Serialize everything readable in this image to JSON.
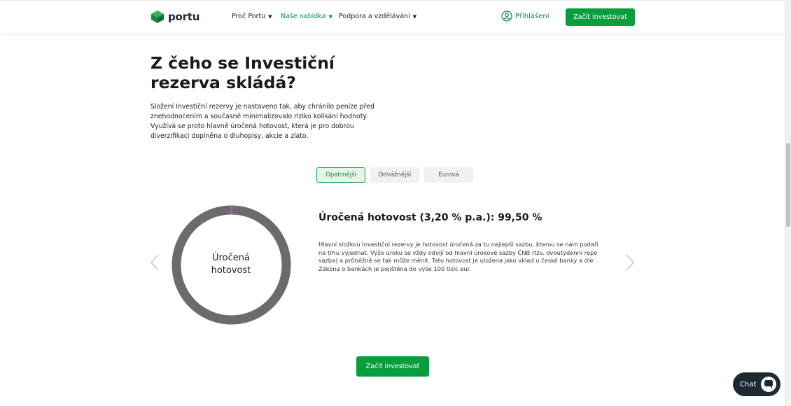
{
  "header": {
    "logo_text": "portu",
    "nav": [
      {
        "label": "Proč Portu"
      },
      {
        "label": "Naše nabídka"
      },
      {
        "label": "Podpora a vzdělávání"
      }
    ],
    "login_label": "Přihlášení",
    "cta_label": "Začít investovat"
  },
  "main": {
    "title": "Z čeho se Investiční rezerva skládá?",
    "intro": "Složení Investiční rezervy je nastaveno tak, aby chránilo peníze před znehodnocením a současně minimalizovalo riziko kolísání hodnoty. Využívá se proto hlavně úročená hotovost, která je pro dobrou diverzifikaci doplněna o dluhopisy, akcie a zlato.",
    "tabs": [
      {
        "label": "Opatrnější",
        "active": true
      },
      {
        "label": "Odvážnější",
        "active": false
      },
      {
        "label": "Eurová",
        "active": false
      }
    ],
    "donut": {
      "center_label": "Úročená hotovost",
      "segments": [
        {
          "value": 99.5,
          "color": "#6b6b6b"
        },
        {
          "value": 0.5,
          "color": "#a64cc4"
        }
      ]
    },
    "component_title": "Úročená hotovost (3,20 % p.a.): 99,50 %",
    "component_description": "Hlavní složkou Investiční rezervy je hotovost úročená za tu nejlepší sazbu, kterou se nám podaří na trhu vyjednat. Výše úroku se vždy odvíjí od hlavní úrokové sazby ČNB (tzv. dvoutýdenní repo sazba) a průběžně se tak může měnit. Tato hotovost je uložena jako vklad u české banky a dle Zákona o bankách je pojištěna do výše 100 tisíc eur.",
    "cta_label": "Začít investovat"
  },
  "chat": {
    "label": "Chat"
  },
  "colors": {
    "brand_green": "#0a9d3e",
    "accent_purple": "#a64cc4",
    "donut_gray": "#6b6b6b"
  }
}
